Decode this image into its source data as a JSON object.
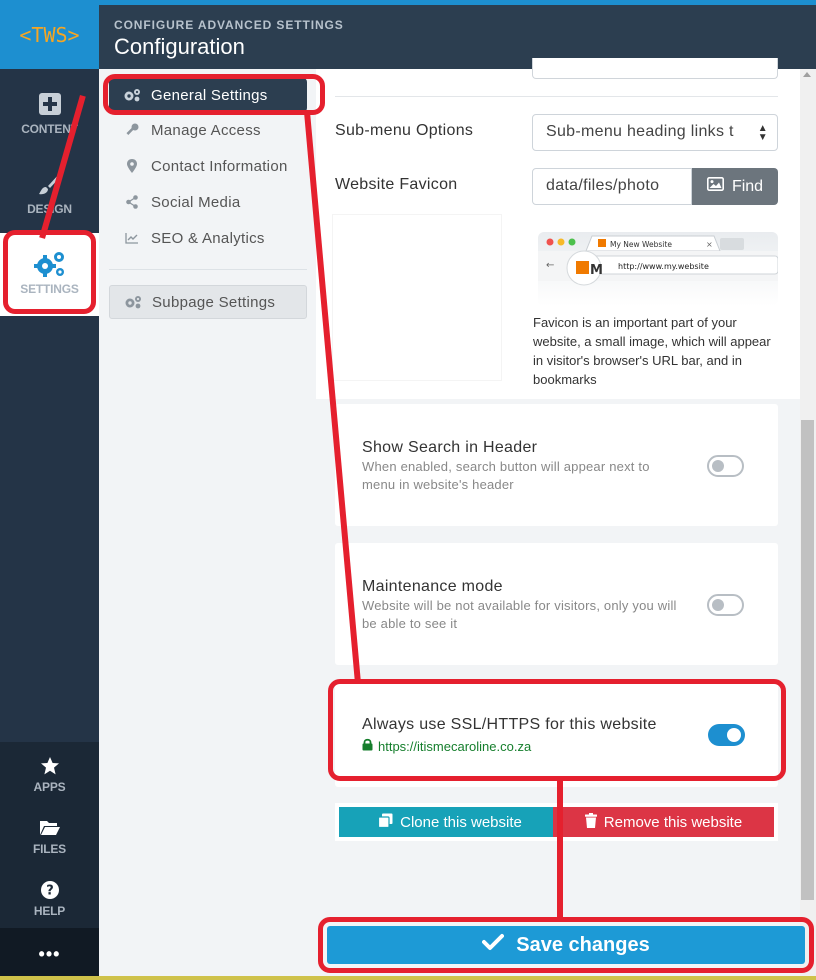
{
  "app": {
    "logo": "<TWS>",
    "header_subtitle": "CONFIGURE ADVANCED SETTINGS",
    "header_title": "Configuration"
  },
  "rail": {
    "items": [
      {
        "label": "CONTENT",
        "icon": "plus-square-icon"
      },
      {
        "label": "DESIGN",
        "icon": "paintbrush-icon"
      },
      {
        "label": "SETTINGS",
        "icon": "cogs-icon",
        "active": true
      },
      {
        "label": "APPS",
        "icon": "star-icon"
      },
      {
        "label": "FILES",
        "icon": "folder-open-icon"
      },
      {
        "label": "HELP",
        "icon": "question-circle-icon"
      }
    ],
    "more": "•••"
  },
  "subnav": {
    "items": [
      {
        "label": "General Settings",
        "icon": "cogs-icon",
        "active": true
      },
      {
        "label": "Manage Access",
        "icon": "key-icon"
      },
      {
        "label": "Contact Information",
        "icon": "map-marker-icon"
      },
      {
        "label": "Social Media",
        "icon": "share-icon"
      },
      {
        "label": "SEO & Analytics",
        "icon": "line-chart-icon"
      }
    ],
    "subpage": {
      "label": "Subpage Settings",
      "icon": "cogs-icon"
    }
  },
  "form": {
    "submenu_label": "Sub-menu Options",
    "submenu_value": "Sub-menu heading links t",
    "favicon_label": "Website Favicon",
    "favicon_value": "data/files/photo",
    "find_label": "Find",
    "browser_tab": "My New Website",
    "browser_url": "http://www.my.website",
    "favicon_help": "Favicon is an important part of your website, a small image, which will appear in visitor's browser's URL bar, and in bookmarks"
  },
  "toggles": {
    "search": {
      "title": "Show Search in Header",
      "desc": "When enabled, search button will appear next to menu in website's header",
      "on": false
    },
    "maintenance": {
      "title": "Maintenance mode",
      "desc": "Website will be not available for visitors, only you will be able to see it",
      "on": false
    },
    "ssl": {
      "title": "Always use SSL/HTTPS for this website",
      "url": "https://itismecaroline.co.za",
      "on": true
    }
  },
  "actions": {
    "clone": "Clone this website",
    "remove": "Remove this website",
    "save": "Save changes"
  },
  "colors": {
    "accent": "#1d8fd0",
    "annotation": "#e5202e",
    "header_bg": "#2c3e50",
    "clone_btn": "#17a2b8",
    "remove_btn": "#dc3545",
    "ssl_green": "#157e2c"
  }
}
